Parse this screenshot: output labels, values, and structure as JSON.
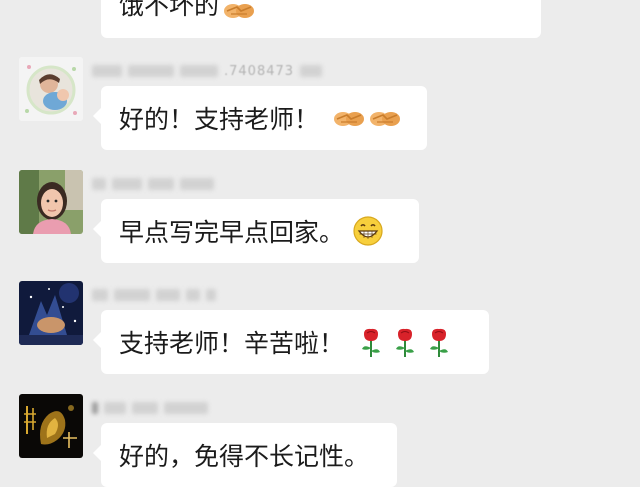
{
  "messages": [
    {
      "text": "饿不坏的",
      "emoji": [
        "handshake-icon"
      ]
    },
    {
      "sender_partial": ".7408473",
      "text": "好的！支持老师！",
      "emoji": [
        "handshake-icon",
        "handshake-icon"
      ]
    },
    {
      "text": "早点写完早点回家。",
      "emoji": [
        "grin-icon"
      ]
    },
    {
      "text": "支持老师！辛苦啦！",
      "emoji": [
        "rose-icon",
        "rose-icon",
        "rose-icon"
      ]
    },
    {
      "text": "好的，免得不长记性。",
      "emoji": []
    }
  ],
  "colors": {
    "background": "#ececec",
    "bubble": "#ffffff",
    "text": "#1b1b1b"
  }
}
